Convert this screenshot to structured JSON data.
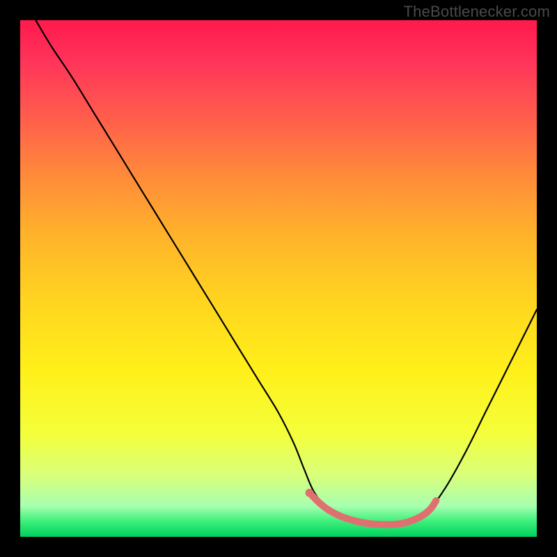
{
  "attribution": "TheBottlenecker.com",
  "chart_data": {
    "type": "line",
    "title": "",
    "xlabel": "",
    "ylabel": "",
    "xlim": [
      0,
      100
    ],
    "ylim": [
      0,
      100
    ],
    "series": [
      {
        "name": "bottleneck-curve",
        "color": "#000000",
        "x": [
          3,
          6,
          10,
          14,
          18,
          22,
          26,
          30,
          34,
          38,
          42,
          46,
          50,
          53,
          55,
          57,
          60,
          63,
          66,
          70,
          74,
          78,
          82,
          86,
          90,
          94,
          98,
          100
        ],
        "values": [
          100,
          95,
          89,
          82.5,
          76,
          69.5,
          63,
          56.5,
          50,
          43.5,
          37,
          30.5,
          24,
          18,
          13,
          8.5,
          5,
          3.2,
          2.6,
          2.4,
          2.6,
          4,
          9,
          16,
          24,
          32,
          40,
          44
        ]
      },
      {
        "name": "highlight-segment",
        "color": "#e07070",
        "x": [
          56,
          58,
          60,
          62,
          64,
          66,
          68,
          70,
          72,
          74,
          76,
          78,
          79.5,
          80.5
        ],
        "values": [
          8.5,
          6.5,
          5,
          4,
          3.3,
          2.8,
          2.5,
          2.4,
          2.4,
          2.6,
          3.2,
          4.2,
          5.5,
          7
        ]
      }
    ],
    "markers": [
      {
        "name": "highlight-start-dot",
        "x": 56,
        "y": 8.5,
        "color": "#e07070"
      }
    ]
  }
}
